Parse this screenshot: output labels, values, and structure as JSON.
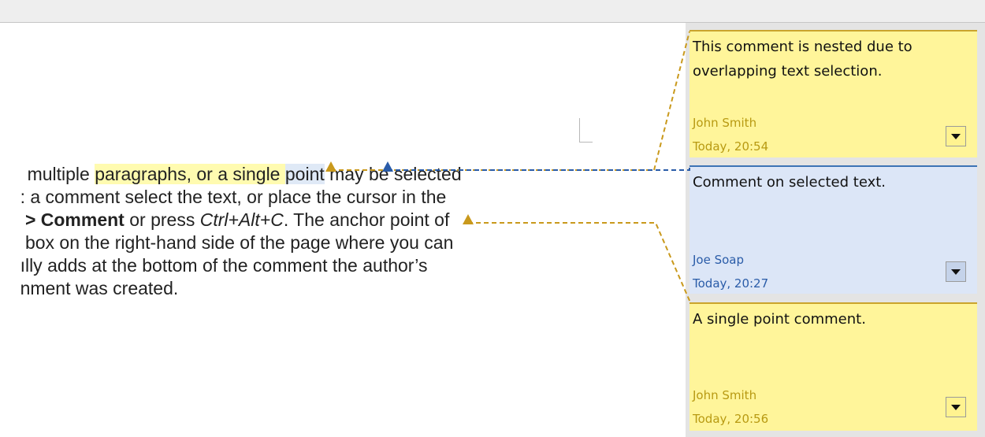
{
  "document": {
    "lines": [
      {
        "segments": [
          {
            "text": "multiple "
          },
          {
            "text": "paragraphs, or a single ",
            "hl": "yellow"
          },
          {
            "text": "point",
            "hl": "blue"
          },
          {
            "text": " may be selected"
          }
        ]
      },
      {
        "segments": [
          {
            "text": ": a comment select the text, or place the cursor in the"
          }
        ]
      },
      {
        "segments": [
          {
            "text": " > Comment",
            "bold": true
          },
          {
            "text": " or press "
          },
          {
            "text": "Ctrl+Alt+C",
            "italic": true
          },
          {
            "text": ". The anchor point of"
          }
        ]
      },
      {
        "segments": [
          {
            "text": " box on the right-hand side of the page where you can"
          }
        ]
      },
      {
        "segments": [
          {
            "text": "ılly adds at the bottom of the comment the author’s"
          }
        ]
      },
      {
        "segments": [
          {
            "text": "nment was created."
          }
        ]
      }
    ]
  },
  "comments": [
    {
      "body": "This comment is nested due to overlapping text selection.",
      "author": "John Smith",
      "date": "Today, 20:54",
      "color": "yellow"
    },
    {
      "body": "Comment on selected text.",
      "author": "Joe Soap",
      "date": "Today, 20:27",
      "color": "blue"
    },
    {
      "body": "A single point comment.",
      "author": "John Smith",
      "date": "Today, 20:56",
      "color": "yellow"
    }
  ],
  "colors": {
    "yellow_anchor": "#c9991c",
    "blue_anchor": "#2a5ca8",
    "yellow_comment_bg": "#fff59a",
    "blue_comment_bg": "#dce6f7"
  },
  "icons": {
    "menu": "chevron-down-icon",
    "anchor": "anchor-triangle-icon"
  }
}
